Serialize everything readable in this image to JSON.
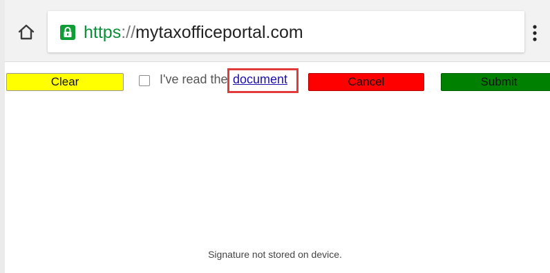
{
  "browser": {
    "url_scheme": "https",
    "url_separator": "://",
    "url_host": "mytaxofficeportal.com",
    "icons": {
      "home": "home-icon",
      "lock": "lock-icon",
      "menu": "more-vert-icon"
    },
    "colors": {
      "secure_green": "#109d37"
    }
  },
  "form": {
    "clear_label": "Clear",
    "agree_text": "I've read the",
    "document_link": "document",
    "cancel_label": "Cancel",
    "submit_label": "Submit",
    "checkbox_checked": false,
    "colors": {
      "clear": "#ffff00",
      "cancel": "#ff0000",
      "submit": "#008000",
      "highlight_box": "#e03a3a"
    }
  },
  "footer": {
    "signature_note": "Signature not stored on device."
  }
}
